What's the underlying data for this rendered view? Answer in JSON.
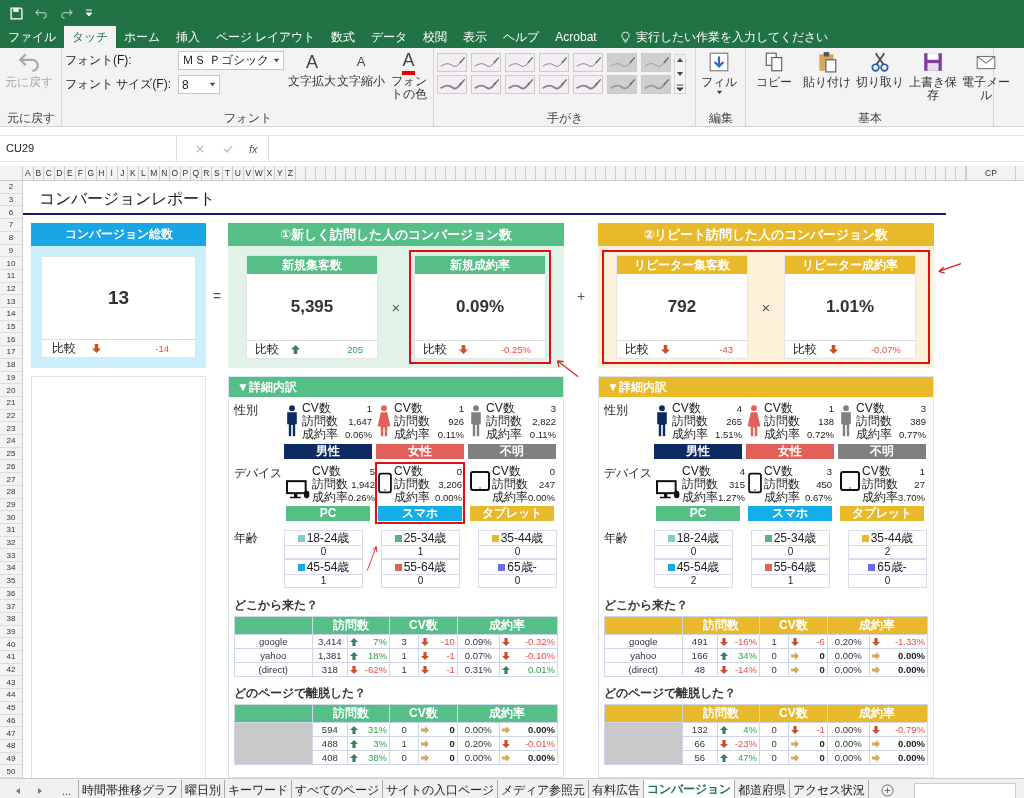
{
  "ribbon_tabs": [
    {
      "label": "ファイル",
      "selected": false
    },
    {
      "label": "タッチ",
      "selected": true
    },
    {
      "label": "ホーム",
      "selected": false
    },
    {
      "label": "挿入",
      "selected": false
    },
    {
      "label": "ページ レイアウト",
      "selected": false
    },
    {
      "label": "数式",
      "selected": false
    },
    {
      "label": "データ",
      "selected": false
    },
    {
      "label": "校閲",
      "selected": false
    },
    {
      "label": "表示",
      "selected": false
    },
    {
      "label": "ヘルプ",
      "selected": false
    },
    {
      "label": "Acrobat",
      "selected": false
    }
  ],
  "tell_me": "実行したい作業を入力してください",
  "undo_group": {
    "button": "元に戻す",
    "disabled": true,
    "label": "元に戻す"
  },
  "font_group": {
    "font_label": "フォント(F):",
    "font_value": "ＭＳ Ｐゴシック",
    "size_label": "フォント サイズ(F):",
    "size_value": "8",
    "label": "フォント",
    "buttons": [
      {
        "kind": "grow",
        "glyph": "A",
        "label": "文字拡大"
      },
      {
        "kind": "shrink",
        "glyph": "A",
        "label": "文字縮小"
      },
      {
        "kind": "color",
        "glyph": "A",
        "label": "フォントの色"
      }
    ]
  },
  "ink_group": {
    "label": "手がき"
  },
  "edit_group": {
    "button": "フィル",
    "label": "編集"
  },
  "basic_group": {
    "label": "基本",
    "buttons": [
      {
        "kind": "copy",
        "label": "コピー"
      },
      {
        "kind": "paste",
        "label": "貼り付け"
      },
      {
        "kind": "cut",
        "label": "切り取り"
      },
      {
        "kind": "save",
        "label": "上書き保存"
      },
      {
        "kind": "mail",
        "label": "電子メール"
      }
    ]
  },
  "formula_bar": {
    "name_box": "CU29",
    "fx": "fx"
  },
  "columns": [
    "A",
    "B",
    "C",
    "D",
    "E",
    "F",
    "G",
    "H",
    "I",
    "J",
    "K",
    "L",
    "M",
    "N",
    "O",
    "P",
    "Q",
    "R",
    "S",
    "T",
    "U",
    "V",
    "W",
    "X",
    "Y",
    "Z"
  ],
  "last_column": "CP",
  "rows": [
    "2",
    "3",
    "6",
    "7",
    "8",
    "9",
    "10",
    "11",
    "12",
    "13",
    "14",
    "15",
    "16",
    "17",
    "18",
    "19",
    "20",
    "21",
    "22",
    "23",
    "24",
    "25",
    "26",
    "27",
    "28",
    "29",
    "30",
    "31",
    "32",
    "33",
    "34",
    "35",
    "36",
    "37",
    "38",
    "39",
    "40",
    "41",
    "42",
    "43",
    "44",
    "45",
    "46",
    "47",
    "48",
    "49",
    "50"
  ],
  "report": {
    "title": "コンバージョンレポート",
    "equals": "=",
    "plus": "+",
    "total": {
      "header": "コンバージョン総数",
      "value": "13",
      "compare_label": "比較",
      "kind": "down",
      "diff": "-14"
    },
    "sections": [
      {
        "title": "①新しく訪問した人のコンバージョン数",
        "color": "#56bf87",
        "group_highlighted": false,
        "operator": "×",
        "cards": [
          {
            "header": "新規集客数",
            "value": "5,395",
            "compare_label": "比較",
            "kind": "up",
            "diff": "205",
            "highlighted": false
          },
          {
            "header": "新規成約率",
            "value": "0.09%",
            "compare_label": "比較",
            "kind": "down",
            "diff": "-0.25%",
            "highlighted": true
          }
        ],
        "detail": {
          "title": "▼詳細内訳",
          "gender": {
            "label": "性別",
            "items": [
              {
                "kind": "male",
                "name": "男性",
                "color": "#0d2a63",
                "stats": [
                  {
                    "label": "CV数",
                    "value": "1"
                  },
                  {
                    "label": "訪問数",
                    "value": "1,647"
                  },
                  {
                    "label": "成約率",
                    "value": "0.06%"
                  }
                ]
              },
              {
                "kind": "female",
                "name": "女性",
                "color": "#e2605a",
                "stats": [
                  {
                    "label": "CV数",
                    "value": "1"
                  },
                  {
                    "label": "訪問数",
                    "value": "926"
                  },
                  {
                    "label": "成約率",
                    "value": "0.11%"
                  }
                ]
              },
              {
                "kind": "unknown",
                "name": "不明",
                "color": "#808080",
                "stats": [
                  {
                    "label": "CV数",
                    "value": "3"
                  },
                  {
                    "label": "訪問数",
                    "value": "2,822"
                  },
                  {
                    "label": "成約率",
                    "value": "0.11%"
                  }
                ]
              }
            ]
          },
          "device": {
            "label": "デバイス",
            "items": [
              {
                "kind": "pc",
                "name": "PC",
                "color": "#56bf87",
                "highlighted": false,
                "stats": [
                  {
                    "label": "CV数",
                    "value": "5"
                  },
                  {
                    "label": "訪問数",
                    "value": "1,942"
                  },
                  {
                    "label": "成約率",
                    "value": "0.26%"
                  }
                ]
              },
              {
                "kind": "phone",
                "name": "スマホ",
                "color": "#12aeea",
                "highlighted": true,
                "stats": [
                  {
                    "label": "CV数",
                    "value": "0"
                  },
                  {
                    "label": "訪問数",
                    "value": "3,206"
                  },
                  {
                    "label": "成約率",
                    "value": "0.00%"
                  }
                ]
              },
              {
                "kind": "tablet",
                "name": "タブレット",
                "color": "#e8b92a",
                "highlighted": false,
                "stats": [
                  {
                    "label": "CV数",
                    "value": "0"
                  },
                  {
                    "label": "訪問数",
                    "value": "247"
                  },
                  {
                    "label": "成約率",
                    "value": "0.00%"
                  }
                ]
              }
            ]
          },
          "age": {
            "label": "年齢",
            "items": [
              {
                "label": "18-24歳",
                "color": "#7fcfc6",
                "value": "0"
              },
              {
                "label": "25-34歳",
                "color": "#4cb882",
                "value": "1"
              },
              {
                "label": "35-44歳",
                "color": "#e8b92a",
                "value": "0"
              },
              {
                "label": "45-54歳",
                "color": "#16a8e8",
                "value": "1"
              },
              {
                "label": "55-64歳",
                "color": "#e2605a",
                "value": "0"
              },
              {
                "label": "65歳-",
                "color": "#6b6bf0",
                "value": "0"
              }
            ]
          },
          "sources": {
            "title": "どこから来た？",
            "headers": [
              "訪問数",
              "CV数",
              "成約率"
            ],
            "rows": [
              {
                "name": "google",
                "cells": [
                  {
                    "value": "3,414",
                    "kind": "up",
                    "change": "7%"
                  },
                  {
                    "value": "3",
                    "kind": "down",
                    "change": "-10"
                  },
                  {
                    "value": "0.09%",
                    "kind": "down",
                    "change": "-0.32%"
                  }
                ]
              },
              {
                "name": "yahoo",
                "cells": [
                  {
                    "value": "1,381",
                    "kind": "up",
                    "change": "18%"
                  },
                  {
                    "value": "1",
                    "kind": "down",
                    "change": "-1"
                  },
                  {
                    "value": "0.07%",
                    "kind": "down",
                    "change": "-0.10%"
                  }
                ]
              },
              {
                "name": "(direct)",
                "cells": [
                  {
                    "value": "318",
                    "kind": "down",
                    "change": "-62%"
                  },
                  {
                    "value": "1",
                    "kind": "down",
                    "change": "-1"
                  },
                  {
                    "value": "0.31%",
                    "kind": "up",
                    "change": "0.01%"
                  }
                ]
              }
            ]
          },
          "exits": {
            "title": "どのページで離脱した？",
            "headers": [
              "訪問数",
              "CV数",
              "成約率"
            ],
            "rows": [
              {
                "cells": [
                  {
                    "value": "594",
                    "kind": "up",
                    "change": "31%"
                  },
                  {
                    "value": "0",
                    "kind": "flat",
                    "change": "0"
                  },
                  {
                    "value": "0.00%",
                    "kind": "flat",
                    "change": "0.00%"
                  }
                ]
              },
              {
                "cells": [
                  {
                    "value": "488",
                    "kind": "up",
                    "change": "3%"
                  },
                  {
                    "value": "1",
                    "kind": "flat",
                    "change": "0"
                  },
                  {
                    "value": "0.20%",
                    "kind": "down",
                    "change": "-0.01%"
                  }
                ]
              },
              {
                "cells": [
                  {
                    "value": "408",
                    "kind": "up",
                    "change": "38%"
                  },
                  {
                    "value": "0",
                    "kind": "flat",
                    "change": "0"
                  },
                  {
                    "value": "0.00%",
                    "kind": "flat",
                    "change": "0.00%"
                  }
                ]
              }
            ]
          }
        }
      },
      {
        "title": "②リピート訪問した人のコンバージョン数",
        "color": "#e8b92a",
        "group_highlighted": true,
        "operator": "×",
        "cards": [
          {
            "header": "リピーター集客数",
            "value": "792",
            "compare_label": "比較",
            "kind": "down",
            "diff": "-43",
            "highlighted": false
          },
          {
            "header": "リピーター成約率",
            "value": "1.01%",
            "compare_label": "比較",
            "kind": "down",
            "diff": "-0.07%",
            "highlighted": false
          }
        ],
        "detail": {
          "title": "▼詳細内訳",
          "gender": {
            "label": "性別",
            "items": [
              {
                "kind": "male",
                "name": "男性",
                "color": "#0d2a63",
                "stats": [
                  {
                    "label": "CV数",
                    "value": "4"
                  },
                  {
                    "label": "訪問数",
                    "value": "265"
                  },
                  {
                    "label": "成約率",
                    "value": "1.51%"
                  }
                ]
              },
              {
                "kind": "female",
                "name": "女性",
                "color": "#e2605a",
                "stats": [
                  {
                    "label": "CV数",
                    "value": "1"
                  },
                  {
                    "label": "訪問数",
                    "value": "138"
                  },
                  {
                    "label": "成約率",
                    "value": "0.72%"
                  }
                ]
              },
              {
                "kind": "unknown",
                "name": "不明",
                "color": "#808080",
                "stats": [
                  {
                    "label": "CV数",
                    "value": "3"
                  },
                  {
                    "label": "訪問数",
                    "value": "389"
                  },
                  {
                    "label": "成約率",
                    "value": "0.77%"
                  }
                ]
              }
            ]
          },
          "device": {
            "label": "デバイス",
            "items": [
              {
                "kind": "pc",
                "name": "PC",
                "color": "#56bf87",
                "highlighted": false,
                "stats": [
                  {
                    "label": "CV数",
                    "value": "4"
                  },
                  {
                    "label": "訪問数",
                    "value": "315"
                  },
                  {
                    "label": "成約率",
                    "value": "1.27%"
                  }
                ]
              },
              {
                "kind": "phone",
                "name": "スマホ",
                "color": "#12aeea",
                "highlighted": false,
                "stats": [
                  {
                    "label": "CV数",
                    "value": "3"
                  },
                  {
                    "label": "訪問数",
                    "value": "450"
                  },
                  {
                    "label": "成約率",
                    "value": "0.67%"
                  }
                ]
              },
              {
                "kind": "tablet",
                "name": "タブレット",
                "color": "#e8b92a",
                "highlighted": false,
                "stats": [
                  {
                    "label": "CV数",
                    "value": "1"
                  },
                  {
                    "label": "訪問数",
                    "value": "27"
                  },
                  {
                    "label": "成約率",
                    "value": "3.70%"
                  }
                ]
              }
            ]
          },
          "age": {
            "label": "年齢",
            "items": [
              {
                "label": "18-24歳",
                "color": "#7fcfc6",
                "value": "0"
              },
              {
                "label": "25-34歳",
                "color": "#4cb882",
                "value": "0"
              },
              {
                "label": "35-44歳",
                "color": "#e8b92a",
                "value": "2"
              },
              {
                "label": "45-54歳",
                "color": "#16a8e8",
                "value": "2"
              },
              {
                "label": "55-64歳",
                "color": "#e2605a",
                "value": "1"
              },
              {
                "label": "65歳-",
                "color": "#6b6bf0",
                "value": "0"
              }
            ]
          },
          "sources": {
            "title": "どこから来た？",
            "headers": [
              "訪問数",
              "CV数",
              "成約率"
            ],
            "rows": [
              {
                "name": "google",
                "cells": [
                  {
                    "value": "491",
                    "kind": "down",
                    "change": "-16%"
                  },
                  {
                    "value": "1",
                    "kind": "down",
                    "change": "-6"
                  },
                  {
                    "value": "0.20%",
                    "kind": "down",
                    "change": "-1.33%"
                  }
                ]
              },
              {
                "name": "yahoo",
                "cells": [
                  {
                    "value": "166",
                    "kind": "up",
                    "change": "34%"
                  },
                  {
                    "value": "0",
                    "kind": "flat",
                    "change": "0"
                  },
                  {
                    "value": "0.00%",
                    "kind": "flat",
                    "change": "0.00%"
                  }
                ]
              },
              {
                "name": "(direct)",
                "cells": [
                  {
                    "value": "48",
                    "kind": "down",
                    "change": "-14%"
                  },
                  {
                    "value": "0",
                    "kind": "flat",
                    "change": "0"
                  },
                  {
                    "value": "0.00%",
                    "kind": "flat",
                    "change": "0.00%"
                  }
                ]
              }
            ]
          },
          "exits": {
            "title": "どのページで離脱した？",
            "headers": [
              "訪問数",
              "CV数",
              "成約率"
            ],
            "rows": [
              {
                "cells": [
                  {
                    "value": "132",
                    "kind": "up",
                    "change": "4%"
                  },
                  {
                    "value": "0",
                    "kind": "down",
                    "change": "-1"
                  },
                  {
                    "value": "0.00%",
                    "kind": "down",
                    "change": "-0.79%"
                  }
                ]
              },
              {
                "cells": [
                  {
                    "value": "66",
                    "kind": "down",
                    "change": "-23%"
                  },
                  {
                    "value": "0",
                    "kind": "flat",
                    "change": "0"
                  },
                  {
                    "value": "0.00%",
                    "kind": "flat",
                    "change": "0.00%"
                  }
                ]
              },
              {
                "cells": [
                  {
                    "value": "56",
                    "kind": "up",
                    "change": "47%"
                  },
                  {
                    "value": "0",
                    "kind": "flat",
                    "change": "0"
                  },
                  {
                    "value": "0.00%",
                    "kind": "flat",
                    "change": "0.00%"
                  }
                ]
              }
            ]
          }
        }
      }
    ]
  },
  "sheet_nav": {
    "more": "..."
  },
  "sheet_tabs": [
    {
      "label": "時間帯推移グラフ",
      "selected": false
    },
    {
      "label": "曜日別",
      "selected": false
    },
    {
      "label": "キーワード",
      "selected": false
    },
    {
      "label": "すべてのページ",
      "selected": false
    },
    {
      "label": "サイトの入口ページ",
      "selected": false
    },
    {
      "label": "メディア参照元",
      "selected": false
    },
    {
      "label": "有料広告",
      "selected": false
    },
    {
      "label": "コンバージョン",
      "selected": true
    },
    {
      "label": "都道府県",
      "selected": false
    },
    {
      "label": "アクセス状況",
      "selected": false
    }
  ]
}
